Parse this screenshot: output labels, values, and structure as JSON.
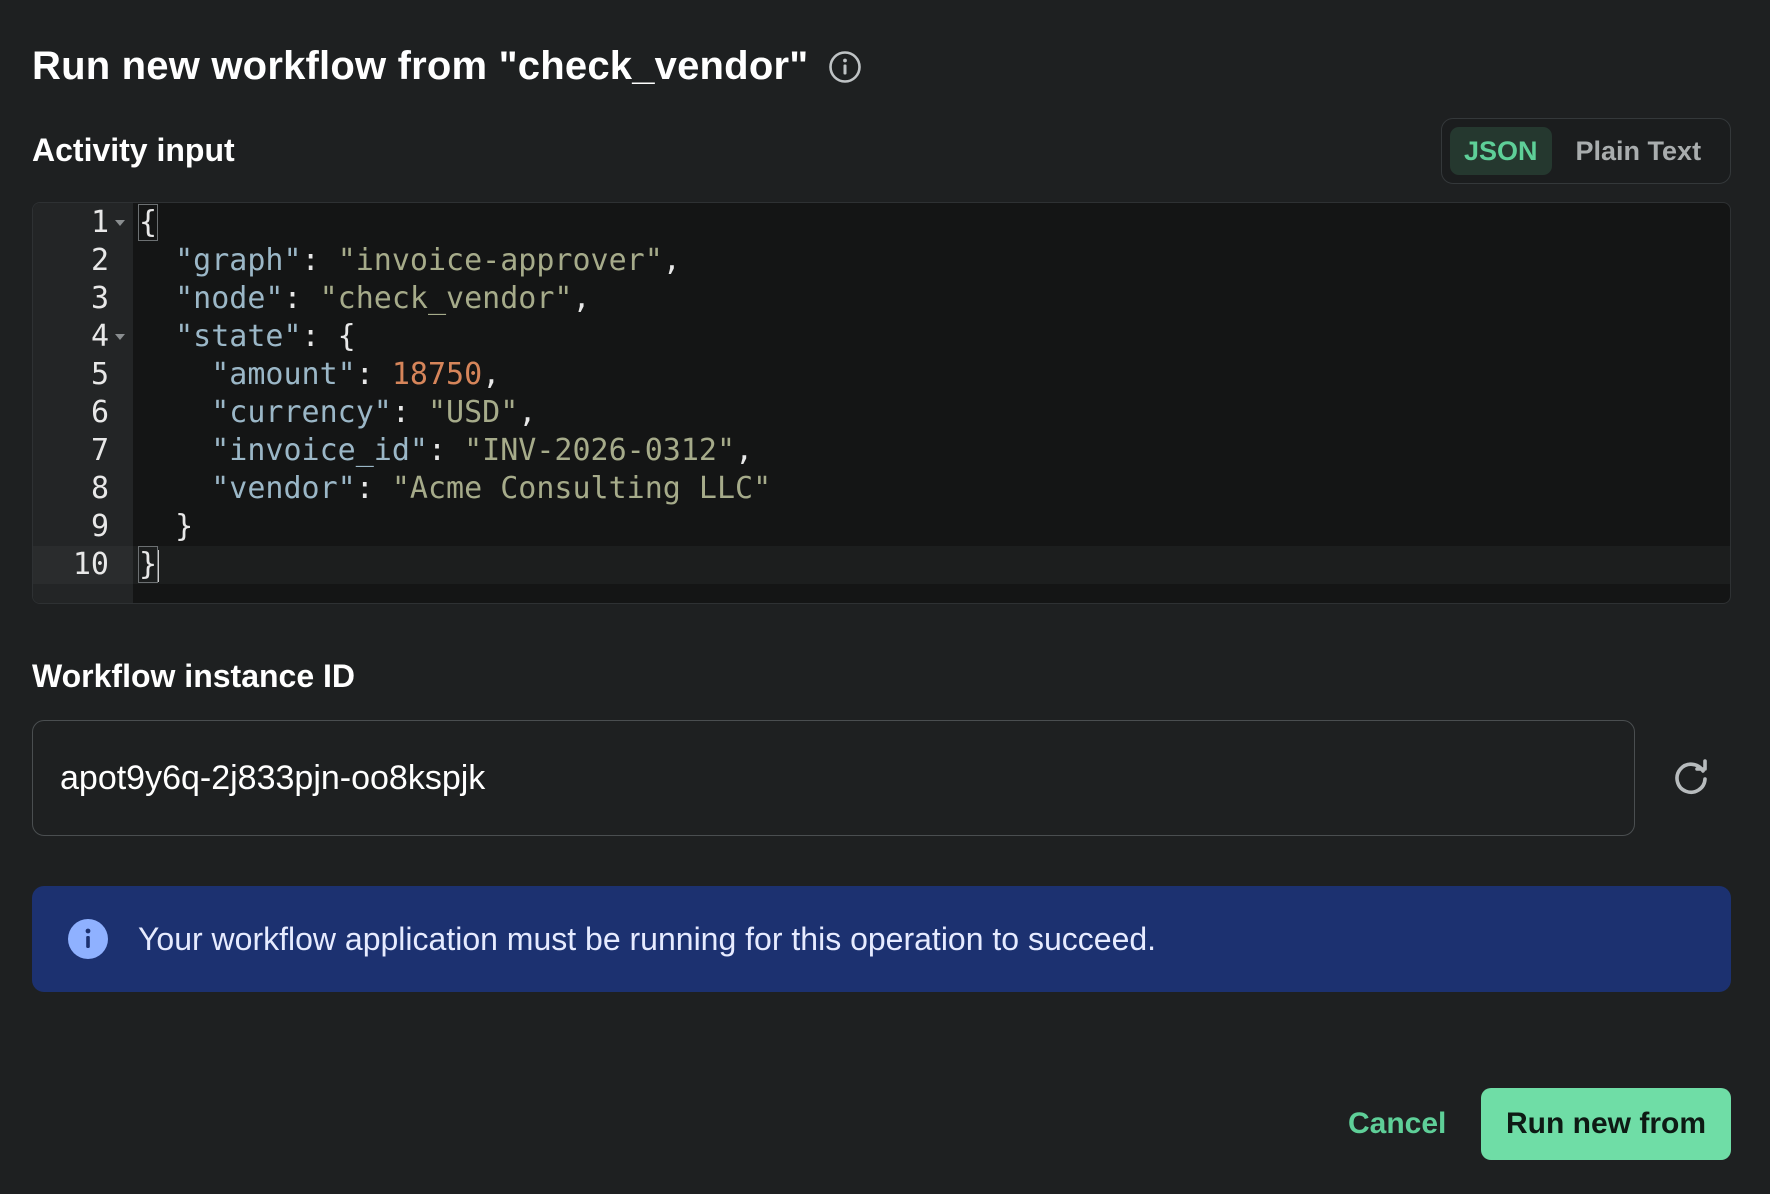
{
  "dialog": {
    "title": "Run new workflow from \"check_vendor\""
  },
  "activity_input": {
    "label": "Activity input",
    "format_options": [
      "JSON",
      "Plain Text"
    ],
    "selected_format": "JSON",
    "line_numbers": [
      "1",
      "2",
      "3",
      "4",
      "5",
      "6",
      "7",
      "8",
      "9",
      "10"
    ],
    "code": {
      "graph_key": "\"graph\"",
      "graph_value": "\"invoice-approver\"",
      "node_key": "\"node\"",
      "node_value": "\"check_vendor\"",
      "state_key": "\"state\"",
      "amount_key": "\"amount\"",
      "amount_value": "18750",
      "currency_key": "\"currency\"",
      "currency_value": "\"USD\"",
      "invoice_id_key": "\"invoice_id\"",
      "invoice_id_value": "\"INV-2026-0312\"",
      "vendor_key": "\"vendor\"",
      "vendor_value": "\"Acme Consulting LLC\""
    }
  },
  "workflow_instance": {
    "label": "Workflow instance ID",
    "value": "apot9y6q-2j833pjn-oo8kspjk"
  },
  "alert": {
    "message": "Your workflow application must be running for this operation to succeed."
  },
  "actions": {
    "cancel_label": "Cancel",
    "run_label": "Run new from"
  },
  "colors": {
    "background": "#1e2021",
    "accent": "#6fdda6",
    "alert_bg": "#1c3170",
    "alert_icon": "#8fb1ff"
  },
  "icons": {
    "title_info": "info-circle-outline-icon",
    "refresh": "refresh-icon",
    "alert_info": "info-circle-filled-icon"
  }
}
